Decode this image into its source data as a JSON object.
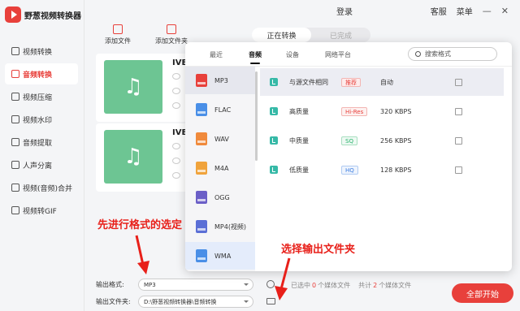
{
  "app": {
    "name": "野葱视频转换器",
    "login": "登录",
    "service": "客服",
    "menu": "菜单",
    "minimize": "—",
    "close": "✕"
  },
  "sidebar": {
    "items": [
      {
        "label": "视频转换",
        "icon": "video-convert-icon"
      },
      {
        "label": "音频转换",
        "icon": "audio-convert-icon",
        "active": true
      },
      {
        "label": "视频压缩",
        "icon": "compress-icon"
      },
      {
        "label": "视频水印",
        "icon": "watermark-icon"
      },
      {
        "label": "音频提取",
        "icon": "audio-extract-icon"
      },
      {
        "label": "人声分离",
        "icon": "vocal-separate-icon"
      },
      {
        "label": "视频(音频)合并",
        "icon": "merge-icon"
      },
      {
        "label": "视频转GIF",
        "icon": "gif-icon"
      }
    ]
  },
  "toolbar": {
    "add_file": "添加文件",
    "add_folder": "添加文件夹"
  },
  "status_tabs": {
    "converting": "正在转换",
    "done": "已完成"
  },
  "files": [
    {
      "title": "IVE",
      "icon": "music-note-icon"
    },
    {
      "title": "IVE",
      "icon": "music-note-icon"
    }
  ],
  "popup": {
    "tabs": [
      "最近",
      "音频",
      "设备",
      "网络平台"
    ],
    "active_tab": "音频",
    "search_placeholder": "搜索格式",
    "formats": [
      {
        "label": "MP3",
        "color": "#e8403b",
        "selected": true
      },
      {
        "label": "FLAC",
        "color": "#4a8fe7"
      },
      {
        "label": "WAV",
        "color": "#f08a3c"
      },
      {
        "label": "M4A",
        "color": "#f0a33c"
      },
      {
        "label": "OGG",
        "color": "#6b5fc7"
      },
      {
        "label": "MP4(视频)",
        "color": "#5b6fd6"
      },
      {
        "label": "WMA",
        "color": "#4a8fe7",
        "hover": true
      }
    ],
    "qualities": [
      {
        "name": "与源文件相同",
        "badge": "推荐",
        "badge_color": "#e8403b",
        "value": "自动",
        "selected": true
      },
      {
        "name": "高质量",
        "badge": "Hi-Res",
        "badge_color": "#e8403b",
        "value": "320 KBPS"
      },
      {
        "name": "中质量",
        "badge": "SQ",
        "badge_color": "#27b36b",
        "value": "256 KBPS"
      },
      {
        "name": "低质量",
        "badge": "HQ",
        "badge_color": "#3b7de0",
        "value": "128 KBPS"
      }
    ]
  },
  "bottom": {
    "format_label": "输出格式:",
    "format_value": "MP3",
    "folder_label": "输出文件夹:",
    "folder_value": "D:\\野葱视频转换器\\音频转换",
    "selected_prefix": "已选中",
    "selected_count": "0",
    "selected_suffix": "个媒体文件",
    "total_prefix": "共计",
    "total_count": "2",
    "total_suffix": "个媒体文件",
    "start_button": "全部开始"
  },
  "annotations": {
    "format_hint": "先进行格式的选定",
    "folder_hint": "选择输出文件夹"
  },
  "colors": {
    "accent": "#e8403b",
    "annotation": "#e8201a",
    "thumb": "#6dc593"
  }
}
